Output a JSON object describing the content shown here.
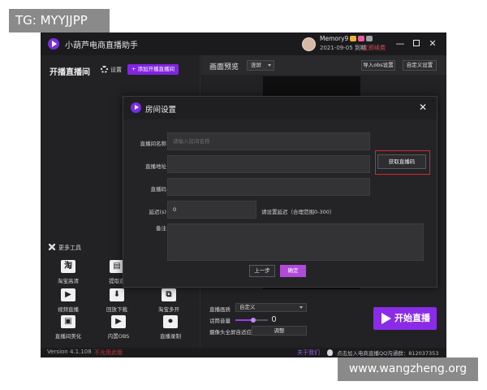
{
  "watermarks": {
    "top_left": "TG: MYYJJPP",
    "bottom_right": "www.wangzheng.org"
  },
  "app": {
    "title": "小葫芦电商直播助手",
    "user": {
      "name": "Memory9",
      "expire": "2021-09-05 到期",
      "renew_label": "立即续费"
    },
    "window_controls": {
      "minimize": "—",
      "close": "✕"
    }
  },
  "left_panel": {
    "title": "开播直播间",
    "settings_label": "设置",
    "add_room_label": "+ 添加开播直播间",
    "tools_header": "更多工具",
    "tools": [
      {
        "label": "淘宝高清",
        "icon": "taobao-hd-icon"
      },
      {
        "label": "提取直",
        "icon": "extract-icon"
      },
      {
        "label": "视频直播",
        "icon": "video-live-icon"
      },
      {
        "label": "回放下载",
        "icon": "replay-download-icon"
      },
      {
        "label": "淘宝多开",
        "icon": "taobao-multi-icon"
      },
      {
        "label": "直播间美化",
        "icon": "beautify-icon"
      },
      {
        "label": "内置OBS",
        "icon": "builtin-obs-icon"
      },
      {
        "label": "直播录制",
        "icon": "record-icon"
      }
    ]
  },
  "preview": {
    "title": "画面预览",
    "ratio": "竖屏",
    "import_obs_label": "导入obs设置",
    "custom_settings_label": "自定义设置"
  },
  "bottom_controls": {
    "quality_label": "直播画质",
    "quality_value": "自定义",
    "volume_label": "话筒音量",
    "volume_level": 0.55,
    "camera_label": "摄像头全屏自适应",
    "adjust_label": "调整",
    "start_label": "开始直播"
  },
  "footer": {
    "version": "Version 4.1.108",
    "update_label": "不允用此版",
    "about_label": "关于我们",
    "qq_group": "点击加入电商直播QQ沟通群：812037353"
  },
  "dialog": {
    "title": "房间设置",
    "close": "✕",
    "fields": [
      {
        "label": "直播间名称",
        "value": "",
        "placeholder": "请输入房间名称"
      },
      {
        "label": "直播地址",
        "value": "",
        "placeholder": ""
      },
      {
        "label": "直播码",
        "value": "",
        "placeholder": ""
      },
      {
        "label": "延迟(s)",
        "value": "0",
        "placeholder": ""
      },
      {
        "label": "备注",
        "value": "",
        "placeholder": ""
      }
    ],
    "delay_hint": "请设置延迟（合理范围0-300）",
    "get_code_label": "获取直播码",
    "prev_label": "上一步",
    "confirm_label": "确定"
  },
  "colors": {
    "accent": "#8a2be8",
    "highlight": "#d42a2a",
    "background": "#222224"
  }
}
